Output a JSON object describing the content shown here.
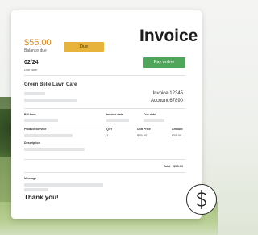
{
  "invoice": {
    "title": "Invoice",
    "amount": "$55.00",
    "balance_label": "Balance due",
    "due_button": "Due",
    "date": "02/24",
    "date_label": "Due date",
    "pay_button": "Pay online",
    "company": "Green Belle Lawn Care",
    "invoice_number": "Invoice 12345",
    "account_number": "Account 67890",
    "labels": {
      "bill_to": "Bill from",
      "payment_date": "Invoice date",
      "due_date": "Due date",
      "product_service": "Product/Service",
      "description": "Description",
      "qty": "QTY",
      "unit_price": "Unit Price",
      "amount": "Amount",
      "total": "Total",
      "message": "Message"
    },
    "line_item": {
      "qty": "1",
      "unit_price": "$55.00",
      "amount": "$55.00"
    },
    "total_value": "$55.00",
    "thank_you": "Thank you!"
  },
  "icons": {
    "badge": "dollar-icon"
  },
  "colors": {
    "amount": "#e0891d",
    "due_button": "#e8b33a",
    "pay_button": "#4fa65a"
  }
}
